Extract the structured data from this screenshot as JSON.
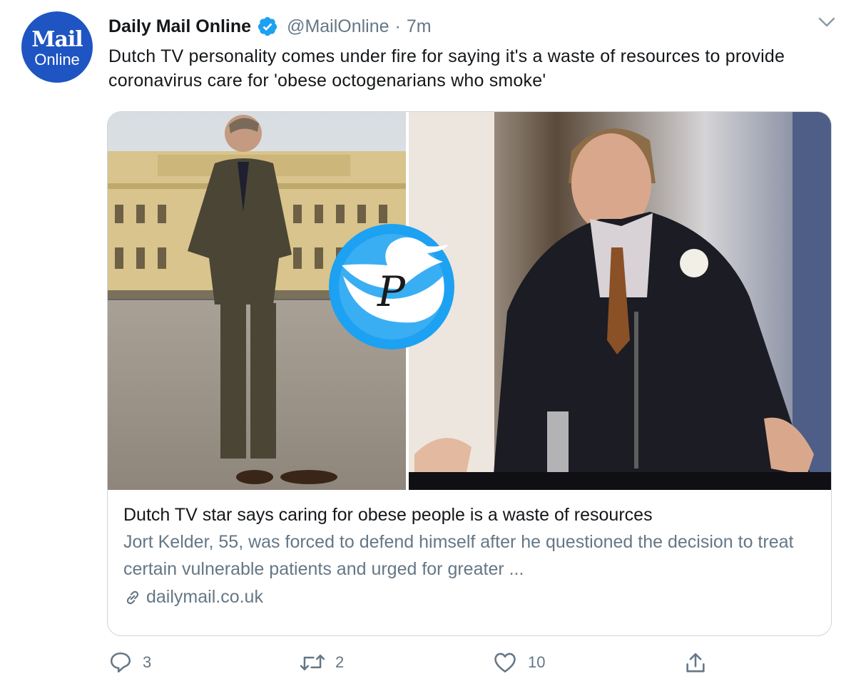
{
  "tweet": {
    "avatar": {
      "line1": "Mail",
      "line2": "Online"
    },
    "author_name": "Daily Mail Online",
    "handle": "@MailOnline",
    "separator": "·",
    "time": "7m",
    "text": "Dutch TV personality comes under fire for saying it's a waste of resources to provide coronavirus care for 'obese octogenarians who smoke'"
  },
  "card": {
    "title": "Dutch TV star says caring for obese people is a waste of resources",
    "description": "Jort Kelder, 55, was forced to defend himself after he questioned the decision to treat certain vulnerable patients and urged for greater ...",
    "domain": "dailymail.co.uk"
  },
  "actions": {
    "reply_count": "3",
    "retweet_count": "2",
    "like_count": "10"
  },
  "colors": {
    "avatar_bg": "#1f55c3",
    "verified": "#1da1f2",
    "muted": "#657786",
    "border": "#ccd6dd"
  },
  "icons": [
    "verified-badge-icon",
    "chevron-down-icon",
    "twitter-bird-watermark-icon",
    "link-icon",
    "reply-icon",
    "retweet-icon",
    "like-icon",
    "share-icon"
  ]
}
